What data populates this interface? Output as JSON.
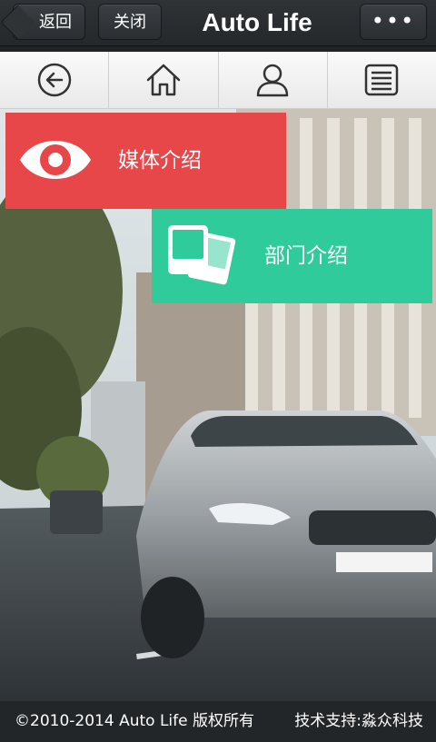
{
  "topbar": {
    "back_label": "返回",
    "close_label": "关闭",
    "title": "Auto Life",
    "more_label": "•••"
  },
  "nav": {
    "items": [
      {
        "icon": "back-arrow-icon"
      },
      {
        "icon": "home-icon"
      },
      {
        "icon": "user-icon"
      },
      {
        "icon": "list-icon"
      }
    ]
  },
  "tiles": [
    {
      "label": "媒体介绍",
      "icon": "eye-icon",
      "color": "#e8474a"
    },
    {
      "label": "部门介绍",
      "icon": "photos-icon",
      "color": "#2fcb9b"
    }
  ],
  "footer": {
    "copyright": "©2010-2014 Auto Life 版权所有",
    "support": "技术支持:淼众科技"
  }
}
